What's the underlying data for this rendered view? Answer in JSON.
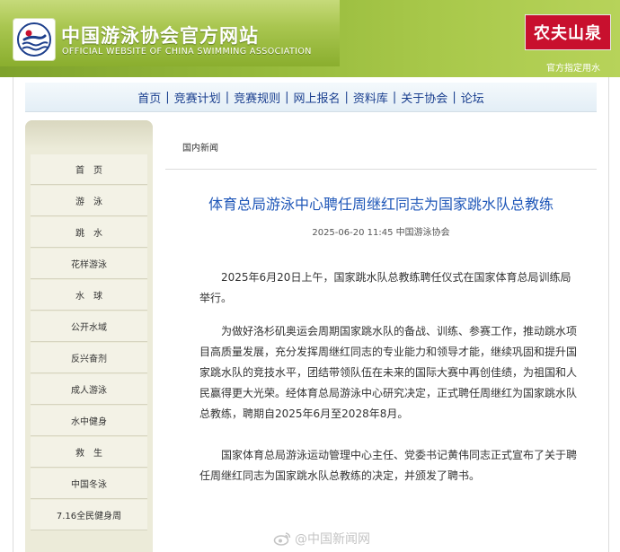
{
  "header": {
    "title": "中国游泳协会官方网站",
    "subtitle": "OFFICIAL WEBSITE OF CHINA SWIMMING ASSOCIATION",
    "sponsor": "农夫山泉",
    "sponsor_note": "官方指定用水",
    "colors": {
      "header_green": "#94b83a",
      "sponsor_red": "#c8102e"
    }
  },
  "nav": {
    "items": [
      "首页",
      "竞赛计划",
      "竞赛规则",
      "网上报名",
      "资料库",
      "关于协会",
      "论坛"
    ],
    "separator": "|"
  },
  "sidebar": {
    "items": [
      "首　页",
      "游　泳",
      "跳　水",
      "花样游泳",
      "水　球",
      "公开水域",
      "反兴奋剂",
      "成人游泳",
      "水中健身",
      "救　生",
      "中国冬泳",
      "7.16全民健身周"
    ]
  },
  "breadcrumb": "国内新闻",
  "article": {
    "title": "体育总局游泳中心聘任周继红同志为国家跳水队总教练",
    "meta": "2025-06-20 11:45 中国游泳协会",
    "paragraphs": [
      "2025年6月20日上午，国家跳水队总教练聘任仪式在国家体育总局训练局举行。",
      "为做好洛杉矶奥运会周期国家跳水队的备战、训练、参赛工作，推动跳水项目高质量发展，充分发挥周继红同志的专业能力和领导才能，继续巩固和提升国家跳水队的竞技水平，团结带领队伍在未来的国际大赛中再创佳绩，为祖国和人民赢得更大光荣。经体育总局游泳中心研究决定，正式聘任周继红为国家跳水队总教练，聘期自2025年6月至2028年8月。",
      "国家体育总局游泳运动管理中心主任、党委书记黄伟同志正式宣布了关于聘任周继红同志为国家跳水队总教练的决定，并颁发了聘书。"
    ]
  },
  "watermark": {
    "text": "@中国新闻网",
    "icon": "weibo-icon"
  }
}
